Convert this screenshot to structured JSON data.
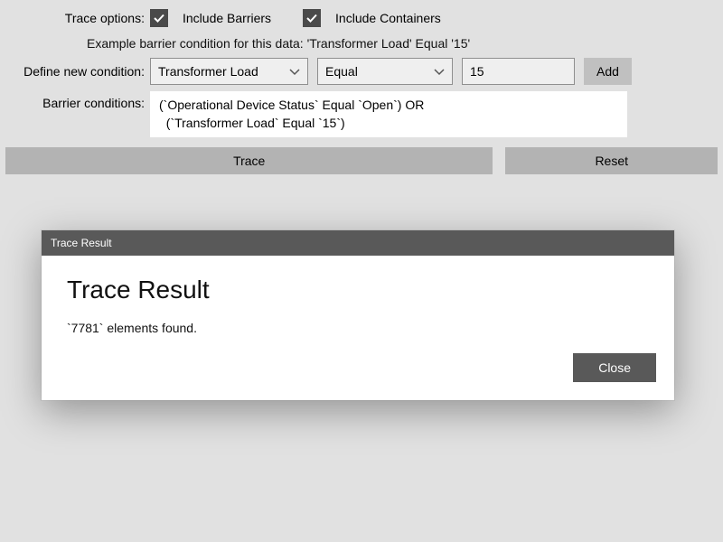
{
  "traceOptions": {
    "label": "Trace options:",
    "includeBarriers": "Include Barriers",
    "includeContainers": "Include Containers"
  },
  "example": "Example barrier condition for this data: 'Transformer Load' Equal '15'",
  "defineCondition": {
    "label": "Define new condition:",
    "fieldSelect": "Transformer Load",
    "operatorSelect": "Equal",
    "valueInput": "15",
    "addButton": "Add"
  },
  "barrierConditions": {
    "label": "Barrier conditions:",
    "text": "(`Operational Device Status` Equal `Open`) OR\n  (`Transformer Load` Equal `15`)"
  },
  "buttons": {
    "trace": "Trace",
    "reset": "Reset"
  },
  "modal": {
    "titlebar": "Trace Result",
    "heading": "Trace Result",
    "message": "`7781` elements found.",
    "close": "Close"
  }
}
